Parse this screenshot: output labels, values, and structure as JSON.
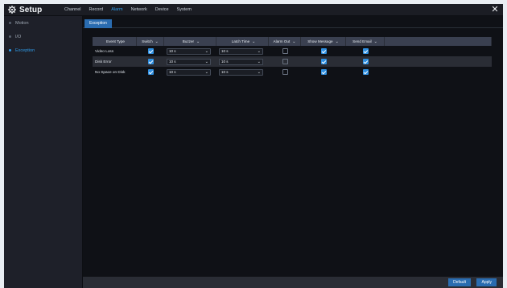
{
  "header": {
    "title": "Setup",
    "nav": [
      "Channel",
      "Record",
      "Alarm",
      "Network",
      "Device",
      "System"
    ],
    "active_nav": "Alarm"
  },
  "sidebar": {
    "items": [
      {
        "label": "Motion",
        "active": false
      },
      {
        "label": "I/O",
        "active": false
      },
      {
        "label": "Exception",
        "active": true
      }
    ]
  },
  "subtab": {
    "label": "Exception"
  },
  "table": {
    "columns": [
      "Event Type",
      "Switch",
      "Buzzer",
      "Latch Time",
      "Alarm Out",
      "Show Message",
      "Send Email"
    ],
    "rows": [
      {
        "event": "Video Loss",
        "switch": true,
        "buzzer": "10 s",
        "latch": "10 s",
        "alarm_out": false,
        "show_message": true,
        "send_email": true
      },
      {
        "event": "Disk Error",
        "switch": true,
        "buzzer": "10 s",
        "latch": "10 s",
        "alarm_out": false,
        "show_message": true,
        "send_email": true
      },
      {
        "event": "No Space on Disk",
        "switch": true,
        "buzzer": "10 s",
        "latch": "10 s",
        "alarm_out": false,
        "show_message": true,
        "send_email": true
      }
    ]
  },
  "footer": {
    "default_label": "Default",
    "apply_label": "Apply"
  },
  "colors": {
    "accent": "#2f9be8",
    "button": "#2a6cb0",
    "background": "#0d0f13",
    "header_row": "#3a4050"
  }
}
